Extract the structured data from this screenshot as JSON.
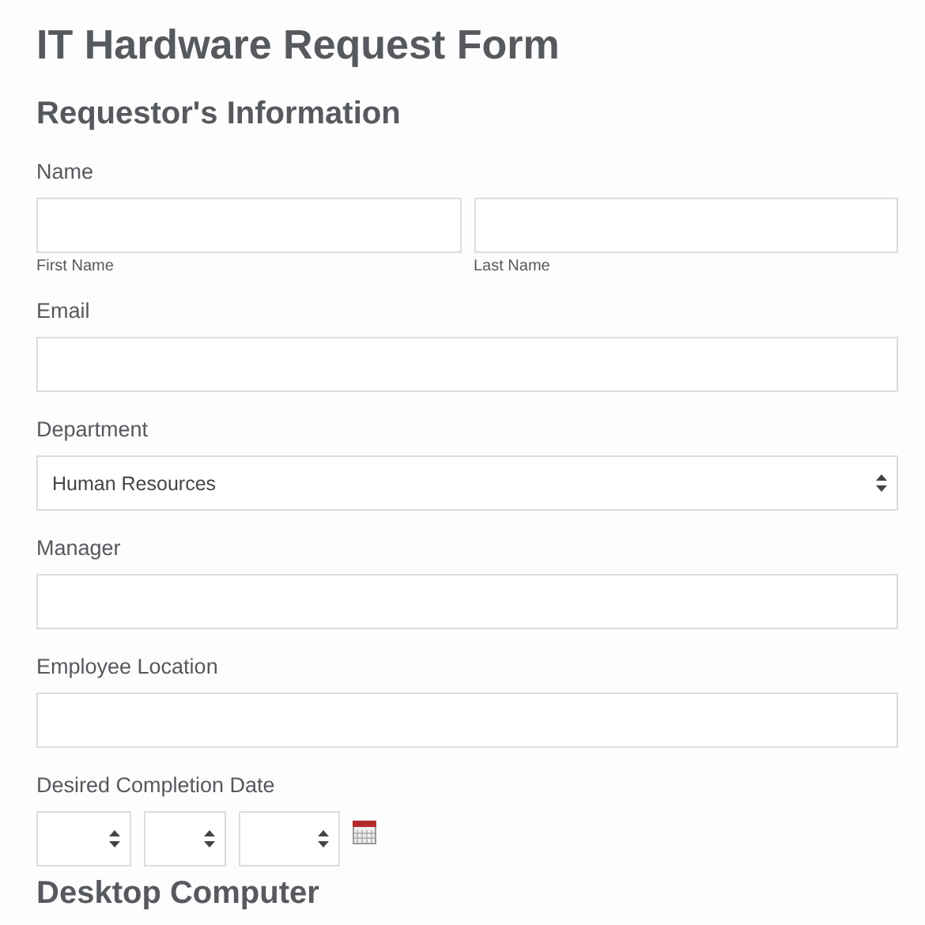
{
  "title": "IT Hardware Request Form",
  "sections": [
    {
      "heading": "Requestor's Information",
      "fields": [
        {
          "kind": "name",
          "label": "Name",
          "parts": [
            {
              "sublabel": "First Name"
            },
            {
              "sublabel": "Last Name"
            }
          ]
        },
        {
          "kind": "text",
          "label": "Email"
        },
        {
          "kind": "select",
          "label": "Department",
          "value": "Human Resources"
        },
        {
          "kind": "text",
          "label": "Manager"
        },
        {
          "kind": "text",
          "label": "Employee Location"
        },
        {
          "kind": "date",
          "label": "Desired Completion Date"
        }
      ]
    },
    {
      "heading": "Desktop Computer"
    }
  ]
}
